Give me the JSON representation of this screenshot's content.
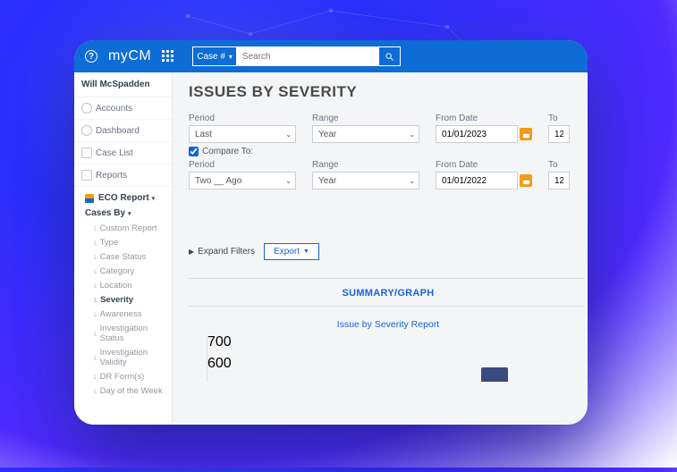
{
  "topbar": {
    "brand": "myCM",
    "search_type": "Case #",
    "search_placeholder": "Search"
  },
  "sidebar": {
    "user": "Will McSpadden",
    "nav": {
      "accounts": "Accounts",
      "dashboard": "Dashboard",
      "caselist": "Case List",
      "reports": "Reports"
    },
    "tree": {
      "eco": "ECO Report",
      "casesby": "Cases By",
      "items": [
        "Custom Report",
        "Type",
        "Case Status",
        "Category",
        "Location",
        "Severity",
        "Awareness",
        "Investigation Status",
        "Investigation Validity",
        "DR Form(s)",
        "Day of the Week"
      ],
      "active_index": 5
    }
  },
  "main": {
    "title": "ISSUES BY SEVERITY",
    "filters": {
      "row1": {
        "period_label": "Period",
        "period_value": "Last",
        "range_label": "Range",
        "range_value": "Year",
        "from_label": "From Date",
        "from_value": "01/01/2023",
        "to_label": "To",
        "to_value": "12"
      },
      "compare": {
        "checked": true,
        "label": "Compare To:"
      },
      "row2": {
        "period_label": "Period",
        "period_value": "Two __ Ago",
        "range_label": "Range",
        "range_value": "Year",
        "from_label": "From Date",
        "from_value": "01/01/2022",
        "to_label": "To",
        "to_value": "12"
      }
    },
    "expand": "Expand Filters",
    "export": "Export",
    "summary_tab": "SUMMARY/GRAPH",
    "chart_title": "Issue by Severity Report"
  },
  "chart_data": {
    "type": "bar",
    "title": "Issue by Severity Report",
    "ylim": [
      600,
      700
    ],
    "y_ticks": [
      600,
      700
    ],
    "visible_bars": [
      {
        "x_position": 0.72,
        "top_visible_at": 620
      }
    ],
    "note": "Chart is cut off at bottom of viewport; only top of one bar and two y-axis labels (700, 600) are visible."
  }
}
